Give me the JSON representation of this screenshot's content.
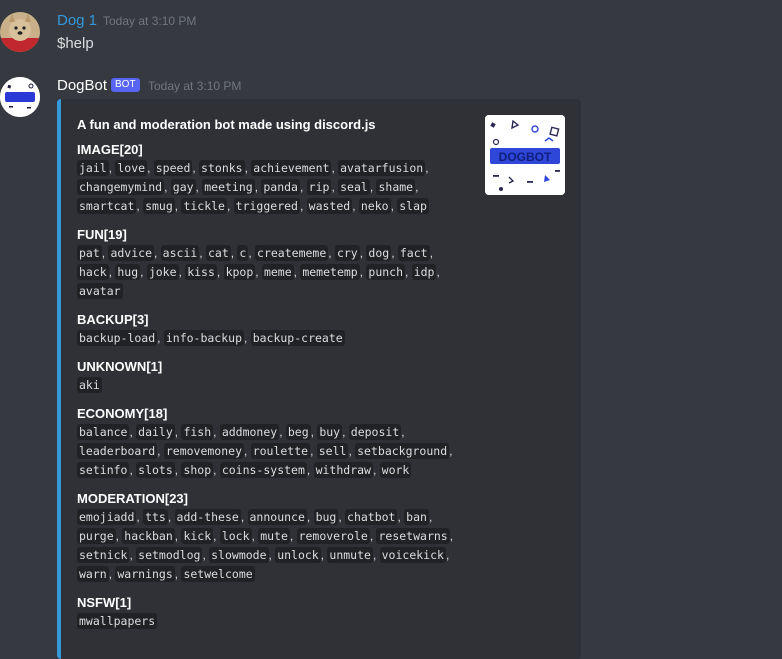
{
  "messages": [
    {
      "username": "Dog 1",
      "timestamp": "Today at 3:10 PM",
      "text": "$help",
      "name_color": "#3498db"
    },
    {
      "username": "DogBot",
      "bot_tag": "BOT",
      "timestamp": "Today at 3:10 PM",
      "name_color": "#ffffff"
    }
  ],
  "embed": {
    "accent_color": "#3498db",
    "title": "A fun and moderation bot made using discord.js",
    "thumbnail_text": "DOGBOT",
    "fields": [
      {
        "name": "IMAGE[20]",
        "lines": [
          [
            "jail",
            "love",
            "speed",
            "stonks",
            "achievement",
            "avatarfusion"
          ],
          [
            "changemymind",
            "gay",
            "meeting",
            "panda",
            "rip",
            "seal",
            "shame"
          ],
          [
            "smartcat",
            "smug",
            "tickle",
            "triggered",
            "wasted",
            "neko",
            "slap"
          ]
        ]
      },
      {
        "name": "FUN[19]",
        "lines": [
          [
            "pat",
            "advice",
            "ascii",
            "cat",
            "c",
            "creatememe",
            "cry",
            "dog",
            "fact"
          ],
          [
            "hack",
            "hug",
            "joke",
            "kiss",
            "kpop",
            "meme",
            "memetemp",
            "punch",
            "idp"
          ],
          [
            "avatar"
          ]
        ]
      },
      {
        "name": "BACKUP[3]",
        "lines": [
          [
            "backup-load",
            "info-backup",
            "backup-create"
          ]
        ]
      },
      {
        "name": "UNKNOWN[1]",
        "lines": [
          [
            "aki"
          ]
        ]
      },
      {
        "name": "ECONOMY[18]",
        "lines": [
          [
            "balance",
            "daily",
            "fish",
            "addmoney",
            "beg",
            "buy",
            "deposit"
          ],
          [
            "leaderboard",
            "removemoney",
            "roulette",
            "sell",
            "setbackground"
          ],
          [
            "setinfo",
            "slots",
            "shop",
            "coins-system",
            "withdraw",
            "work"
          ]
        ]
      },
      {
        "name": "MODERATION[23]",
        "lines": [
          [
            "emojiadd",
            "tts",
            "add-these",
            "announce",
            "bug",
            "chatbot",
            "ban"
          ],
          [
            "purge",
            "hackban",
            "kick",
            "lock",
            "mute",
            "removerole",
            "resetwarns"
          ],
          [
            "setnick",
            "setmodlog",
            "slowmode",
            "unlock",
            "unmute",
            "voicekick"
          ],
          [
            "warn",
            "warnings",
            "setwelcome"
          ]
        ]
      },
      {
        "name": "NSFW[1]",
        "lines": [
          [
            "mwallpapers"
          ]
        ]
      }
    ]
  }
}
